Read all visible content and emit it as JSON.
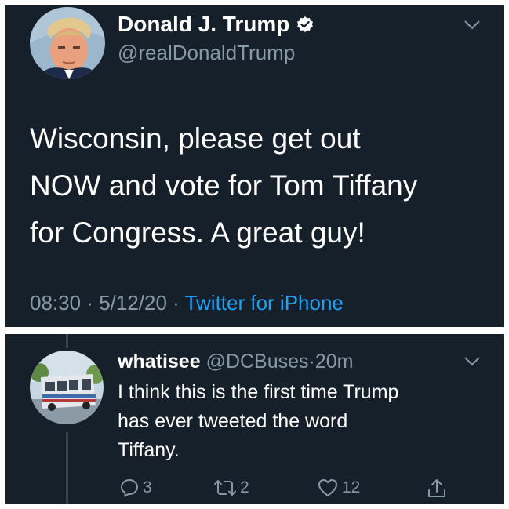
{
  "main_tweet": {
    "display_name": "Donald J. Trump",
    "handle": "@realDonaldTrump",
    "text_lines": [
      "Wisconsin, please get out",
      "NOW and vote for Tom Tiffany",
      "for Congress. A great guy!"
    ],
    "time": "08:30",
    "date": "5/12/20",
    "separator": " · ",
    "source": "Twitter for iPhone"
  },
  "reply_tweet": {
    "display_name": "whatisee",
    "handle": "@DCBuses",
    "separator": "·",
    "age": "20m",
    "text_lines": [
      "I think this is the first time Trump",
      "has ever tweeted the word",
      "Tiffany."
    ],
    "reply_count": "3",
    "retweet_count": "2",
    "like_count": "12"
  },
  "colors": {
    "background": "#15202b",
    "border": "#ffffff",
    "primary_text": "#ffffff",
    "secondary_text": "#8899a6",
    "accent": "#1da1f2"
  },
  "icons": [
    "verified-badge-icon",
    "chevron-down-icon",
    "reply-icon",
    "retweet-icon",
    "like-icon",
    "share-icon"
  ]
}
